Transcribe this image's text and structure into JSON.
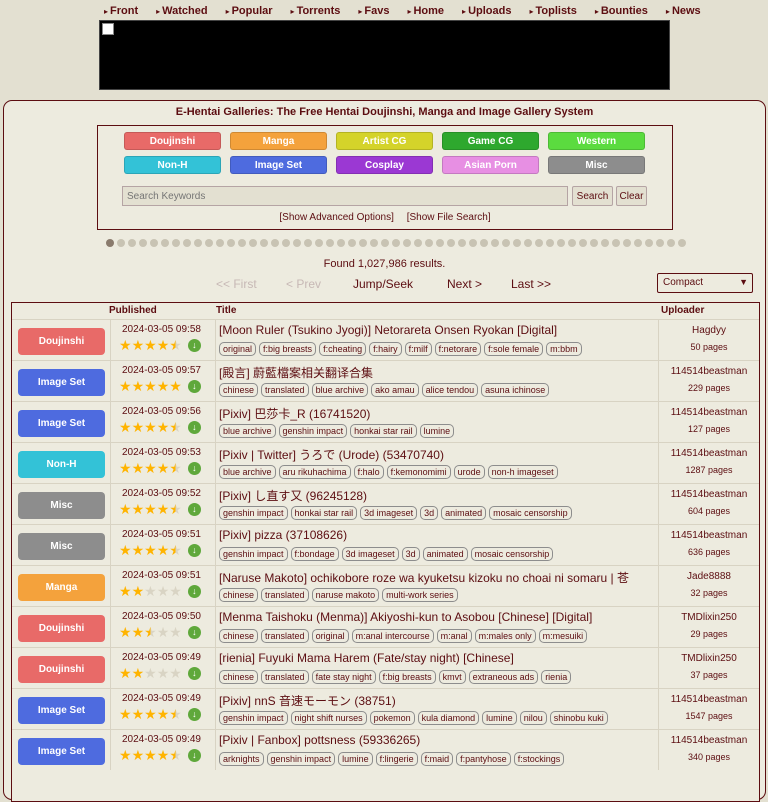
{
  "nav": [
    "Front",
    "Watched",
    "Popular",
    "Torrents",
    "Favs",
    "Home",
    "Uploads",
    "Toplists",
    "Bounties",
    "News"
  ],
  "site_title": "E-Hentai Galleries: The Free Hentai Doujinshi, Manga and Image Gallery System",
  "categories": [
    {
      "label": "Doujinshi",
      "color": "#e86a68"
    },
    {
      "label": "Manga",
      "color": "#f4a23c"
    },
    {
      "label": "Artist CG",
      "color": "#d4d32a"
    },
    {
      "label": "Game CG",
      "color": "#2ea82e"
    },
    {
      "label": "Western",
      "color": "#5bdb3f"
    },
    {
      "label": "Non-H",
      "color": "#33c2d7"
    },
    {
      "label": "Image Set",
      "color": "#4e6bdf"
    },
    {
      "label": "Cosplay",
      "color": "#9b38d3"
    },
    {
      "label": "Asian Porn",
      "color": "#e78fe3"
    },
    {
      "label": "Misc",
      "color": "#8d8d8d"
    }
  ],
  "search": {
    "placeholder": "Search Keywords",
    "search_button": "Search",
    "clear_button": "Clear",
    "advanced_link": "[Show Advanced Options]",
    "file_link": "[Show File Search]"
  },
  "found": "Found 1,027,986 results.",
  "pager": {
    "first": "<< First",
    "prev": "< Prev",
    "jump": "Jump/Seek",
    "next": "Next >",
    "last": "Last >>"
  },
  "display_mode": "Compact",
  "columns": {
    "published": "Published",
    "title": "Title",
    "uploader": "Uploader"
  },
  "galleries": [
    {
      "category": "Doujinshi",
      "color": "#e86a68",
      "published": "2024-03-05 09:58",
      "rating": 4.5,
      "title": "[Moon Ruler (Tsukino Jyogi)] Netorareta Onsen Ryokan [Digital]",
      "tags": [
        "original",
        "f:big breasts",
        "f:cheating",
        "f:hairy",
        "f:milf",
        "f:netorare",
        "f:sole female",
        "m:bbm"
      ],
      "uploader": "Hagdyy",
      "pages": "50 pages"
    },
    {
      "category": "Image Set",
      "color": "#4e6bdf",
      "published": "2024-03-05 09:57",
      "rating": 5,
      "title": "[殿言] 蔚藍檔案相关翻译合集",
      "tags": [
        "chinese",
        "translated",
        "blue archive",
        "ako amau",
        "alice tendou",
        "asuna ichinose"
      ],
      "uploader": "114514beastman",
      "pages": "229 pages"
    },
    {
      "category": "Image Set",
      "color": "#4e6bdf",
      "published": "2024-03-05 09:56",
      "rating": 4.5,
      "title": "[Pixiv] 巴莎卡_R (16741520)",
      "tags": [
        "blue archive",
        "genshin impact",
        "honkai star rail",
        "lumine"
      ],
      "uploader": "114514beastman",
      "pages": "127 pages"
    },
    {
      "category": "Non-H",
      "color": "#33c2d7",
      "published": "2024-03-05 09:53",
      "rating": 4.5,
      "title": "[Pixiv | Twitter] うろで (Urode) (53470740)",
      "tags": [
        "blue archive",
        "aru rikuhachima",
        "f:halo",
        "f:kemonomimi",
        "urode",
        "non-h imageset"
      ],
      "uploader": "114514beastman",
      "pages": "1287 pages"
    },
    {
      "category": "Misc",
      "color": "#8d8d8d",
      "published": "2024-03-05 09:52",
      "rating": 4.5,
      "title": "[Pixiv] し直す又 (96245128)",
      "tags": [
        "genshin impact",
        "honkai star rail",
        "3d imageset",
        "3d",
        "animated",
        "mosaic censorship"
      ],
      "uploader": "114514beastman",
      "pages": "604 pages"
    },
    {
      "category": "Misc",
      "color": "#8d8d8d",
      "published": "2024-03-05 09:51",
      "rating": 4.5,
      "title": "[Pixiv] pizza (37108626)",
      "tags": [
        "genshin impact",
        "f:bondage",
        "3d imageset",
        "3d",
        "animated",
        "mosaic censorship"
      ],
      "uploader": "114514beastman",
      "pages": "636 pages"
    },
    {
      "category": "Manga",
      "color": "#f4a23c",
      "published": "2024-03-05 09:51",
      "rating": 2,
      "title": "[Naruse Makoto] ochikobore roze wa kyuketsu kizoku no choai ni somaru | 苍",
      "tags": [
        "chinese",
        "translated",
        "naruse makoto",
        "multi-work series"
      ],
      "uploader": "Jade8888",
      "pages": "32 pages"
    },
    {
      "category": "Doujinshi",
      "color": "#e86a68",
      "published": "2024-03-05 09:50",
      "rating": 2.5,
      "title": "[Menma Taishoku (Menma)] Akiyoshi-kun to Asobou [Chinese] [Digital]",
      "tags": [
        "chinese",
        "translated",
        "original",
        "m:anal intercourse",
        "m:anal",
        "m:males only",
        "m:mesuiki"
      ],
      "uploader": "TMDlixin250",
      "pages": "29 pages"
    },
    {
      "category": "Doujinshi",
      "color": "#e86a68",
      "published": "2024-03-05 09:49",
      "rating": 2,
      "title": "[rienia] Fuyuki Mama Harem (Fate/stay night) [Chinese]",
      "tags": [
        "chinese",
        "translated",
        "fate stay night",
        "f:big breasts",
        "kmvt",
        "extraneous ads",
        "rienia"
      ],
      "uploader": "TMDlixin250",
      "pages": "37 pages"
    },
    {
      "category": "Image Set",
      "color": "#4e6bdf",
      "published": "2024-03-05 09:49",
      "rating": 4.5,
      "title": "[Pixiv] nnS 音速モーモン (38751)",
      "tags": [
        "genshin impact",
        "night shift nurses",
        "pokemon",
        "kula diamond",
        "lumine",
        "nilou",
        "shinobu kuki"
      ],
      "uploader": "114514beastman",
      "pages": "1547 pages"
    },
    {
      "category": "Image Set",
      "color": "#4e6bdf",
      "published": "2024-03-05 09:49",
      "rating": 4.5,
      "title": "[Pixiv | Fanbox] pottsness (59336265)",
      "tags": [
        "arknights",
        "genshin impact",
        "lumine",
        "f:lingerie",
        "f:maid",
        "f:pantyhose",
        "f:stockings"
      ],
      "uploader": "114514beastman",
      "pages": "340 pages"
    }
  ],
  "page_dot_count": 53,
  "page_dot_active": 1
}
